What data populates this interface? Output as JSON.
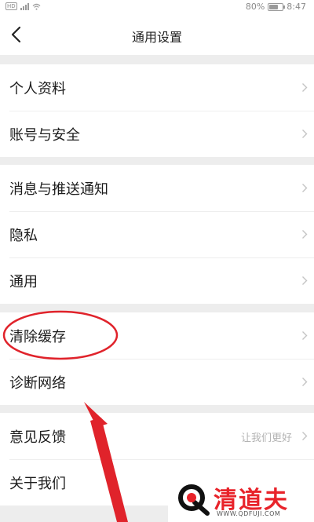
{
  "status_bar": {
    "network_badge": "HD",
    "battery_text": "80%",
    "battery_level": 0.8,
    "time": "8:47"
  },
  "nav": {
    "back_icon": "back-arrow-icon",
    "title": "通用设置"
  },
  "groups": [
    {
      "items": [
        {
          "label": "个人资料",
          "hint": ""
        },
        {
          "label": "账号与安全",
          "hint": ""
        }
      ]
    },
    {
      "items": [
        {
          "label": "消息与推送通知",
          "hint": ""
        },
        {
          "label": "隐私",
          "hint": ""
        },
        {
          "label": "通用",
          "hint": ""
        }
      ]
    },
    {
      "items": [
        {
          "label": "清除缓存",
          "hint": ""
        },
        {
          "label": "诊断网络",
          "hint": ""
        }
      ]
    },
    {
      "items": [
        {
          "label": "意见反馈",
          "hint": "让我们更好"
        },
        {
          "label": "关于我们",
          "hint": ""
        }
      ]
    }
  ],
  "annotation": {
    "highlight_color": "#e0232b",
    "arrow_color": "#e0232b"
  },
  "watermark": {
    "name": "清道夫",
    "url": "WWW.QDFUJI.COM",
    "color": "#e8232a"
  }
}
